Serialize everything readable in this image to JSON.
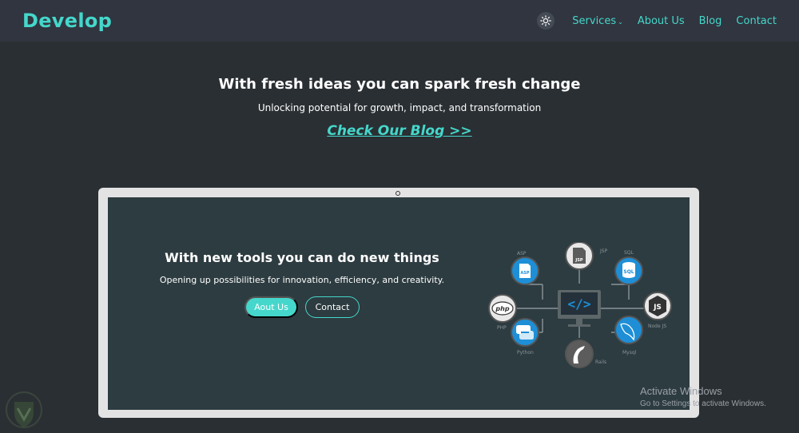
{
  "nav": {
    "brand": "Develop",
    "links": [
      {
        "label": "Services"
      },
      {
        "label": "About Us"
      },
      {
        "label": "Blog"
      },
      {
        "label": "Contact"
      }
    ]
  },
  "hero": {
    "title": "With fresh ideas you can spark fresh change",
    "subtitle": "Unlocking potential for growth, impact, and transformation",
    "link": "Check Our Blog >>"
  },
  "feature": {
    "title": "With new tools you can do new things",
    "subtitle": "Opening up possibilities for innovation, efficiency, and creativity.",
    "primary_button": "Aout Us",
    "secondary_button": "Contact"
  },
  "tech": {
    "center": "</>",
    "items": {
      "asp": "ASP",
      "jsp": "JSP",
      "sql": "SQL",
      "php": "PHP",
      "node": "Node JS",
      "python": "Python",
      "mysql": "Mysql",
      "rails": "Rails"
    }
  },
  "watermark": {
    "title": "Activate Windows",
    "subtitle": "Go to Settings to activate Windows."
  },
  "colors": {
    "accent": "#45d7cb",
    "background": "#2a2f33",
    "navbar": "#30353f",
    "screen": "#2d3c41",
    "tech_blue": "#1e8fd6"
  }
}
